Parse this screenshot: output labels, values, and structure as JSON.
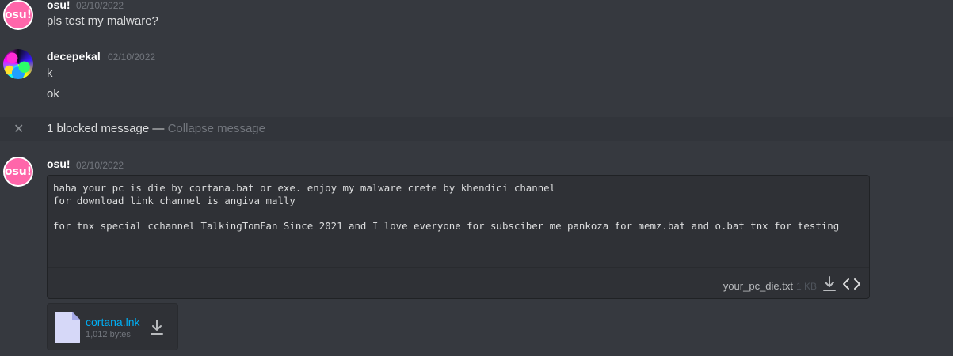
{
  "messages": [
    {
      "username": "osu!",
      "timestamp": "02/10/2022",
      "avatar_text": "osu!",
      "lines": [
        "pls test my malware?"
      ]
    },
    {
      "username": "decepekal",
      "timestamp": "02/10/2022",
      "lines": [
        "k",
        "ok"
      ]
    }
  ],
  "blocked": {
    "text": "1 blocked message",
    "separator": " — ",
    "collapse_label": "Collapse message"
  },
  "last_message": {
    "username": "osu!",
    "timestamp": "02/10/2022",
    "avatar_text": "osu!",
    "code_preview": {
      "content": "haha your pc is die by cortana.bat or exe. enjoy my malware crete by khendici channel\nfor download link channel is angiva mally\n\nfor tnx special cchannel TalkingTomFan Since 2021 and I love everyone for subsciber me pankoza for memz.bat and o.bat tnx for testing",
      "file_name": "your_pc_die.txt",
      "file_size": "1 KB"
    },
    "attachment": {
      "file_name": "cortana.lnk",
      "file_size": "1,012 bytes"
    }
  },
  "colors": {
    "background": "#36393f",
    "link": "#00aff4",
    "osu_pink": "#ff66aa"
  },
  "icons": [
    "close-icon",
    "download-icon",
    "expand-code-icon",
    "file-icon"
  ]
}
